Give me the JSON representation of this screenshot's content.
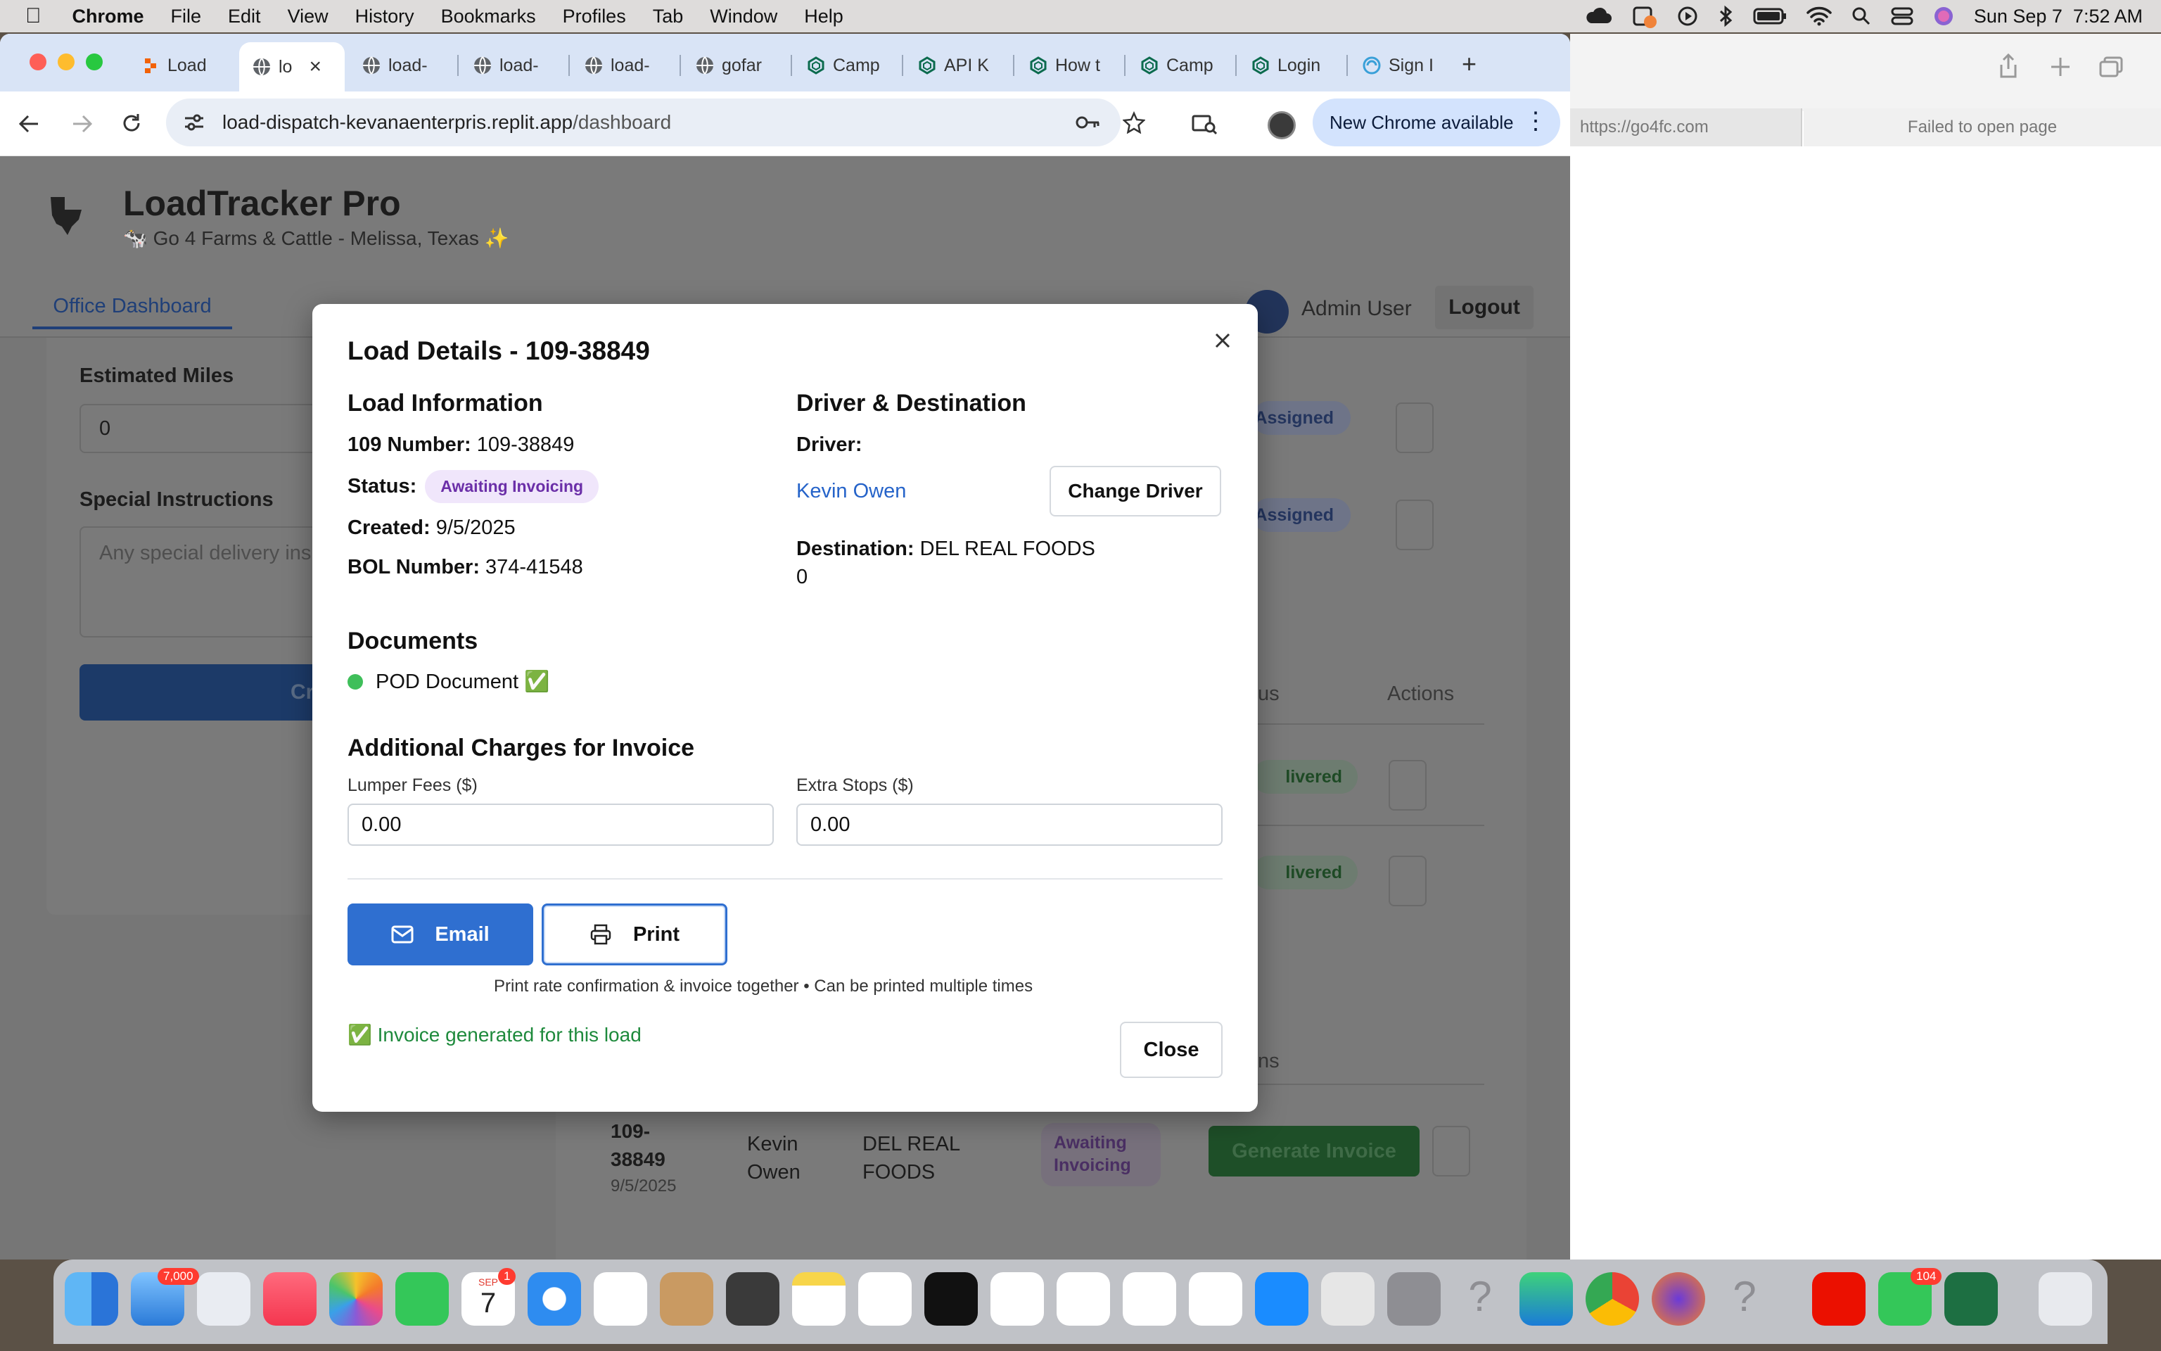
{
  "menubar": {
    "app_name": "Chrome",
    "items": [
      "File",
      "Edit",
      "View",
      "History",
      "Bookmarks",
      "Profiles",
      "Tab",
      "Window",
      "Help"
    ],
    "datetime": "Sun Sep 7  7:52 AM"
  },
  "tabs": [
    {
      "label": "Load",
      "icon": "replit-icon"
    },
    {
      "label": "lo",
      "icon": "globe-icon",
      "active": true
    },
    {
      "label": "load-",
      "icon": "globe-icon"
    },
    {
      "label": "load-",
      "icon": "globe-icon"
    },
    {
      "label": "load-",
      "icon": "globe-icon"
    },
    {
      "label": "gofar",
      "icon": "globe-icon"
    },
    {
      "label": "Camp",
      "icon": "openai-icon"
    },
    {
      "label": "API K",
      "icon": "openai-icon"
    },
    {
      "label": "How t",
      "icon": "openai-icon"
    },
    {
      "label": "Camp",
      "icon": "openai-icon"
    },
    {
      "label": "Login",
      "icon": "openai-icon"
    },
    {
      "label": "Sign I",
      "icon": "swirl-icon"
    }
  ],
  "toolbar": {
    "url_domain": "load-dispatch-kevanaenterpris.replit.app",
    "url_path": "/dashboard",
    "new_chrome_label": "New Chrome available"
  },
  "app": {
    "title": "LoadTracker Pro",
    "subtitle": "🐄 Go 4 Farms & Cattle - Melissa, Texas ✨",
    "nav_tab": "Office Dashboard",
    "user_name": "Admin User",
    "logout_label": "Logout"
  },
  "form": {
    "miles_label": "Estimated Miles",
    "miles_value": "0",
    "instructions_label": "Special Instructions",
    "instructions_placeholder": "Any special delivery ins",
    "create_button": "Create L"
  },
  "background_table": {
    "statuses": [
      "Assigned",
      "Assigned"
    ],
    "col_status": "tus",
    "col_actions": "Actions",
    "delivered": [
      "livered",
      "livered"
    ],
    "section_partial": "ns",
    "row": {
      "load_number": "109-\n38849",
      "date": "9/5/2025",
      "driver": "Kevin\nOwen",
      "destination": "DEL REAL\nFOODS",
      "status": "Awaiting\nInvoicing",
      "action": "Generate Invoice"
    }
  },
  "modal": {
    "title": "Load Details - 109-38849",
    "load_info_heading": "Load Information",
    "number_label": "109 Number:",
    "number_value": "109-38849",
    "status_label": "Status:",
    "status_value": "Awaiting Invoicing",
    "created_label": "Created:",
    "created_value": "9/5/2025",
    "bol_label": "BOL Number:",
    "bol_value": "374-41548",
    "driver_heading": "Driver & Destination",
    "driver_label": "Driver:",
    "driver_name": "Kevin Owen",
    "change_driver": "Change Driver",
    "destination_label": "Destination:",
    "destination_value": "DEL REAL FOODS",
    "destination_extra": "0",
    "documents_heading": "Documents",
    "document_item": "POD Document ✅",
    "charges_heading": "Additional Charges for Invoice",
    "lumper_label": "Lumper Fees ($)",
    "lumper_value": "0.00",
    "extra_label": "Extra Stops ($)",
    "extra_value": "0.00",
    "email_button": "Email",
    "print_button": "Print",
    "print_note": "Print rate confirmation & invoice together • Can be printed multiple times",
    "invoice_note": "✅ Invoice generated for this load",
    "close_button": "Close"
  },
  "other_window": {
    "url": "https://go4fc.com",
    "status": "Failed to open page"
  },
  "dock": {
    "mail_badge": "7,000",
    "calendar_month": "SEP",
    "calendar_day": "7",
    "calendar_badge": "1",
    "messages_badge": "104"
  },
  "colors": {
    "primary": "#2f6fd0",
    "status_bg": "#f0e6fb",
    "status_text": "#6b2fa8",
    "success": "#1e8a3c",
    "link": "#2563c9"
  }
}
